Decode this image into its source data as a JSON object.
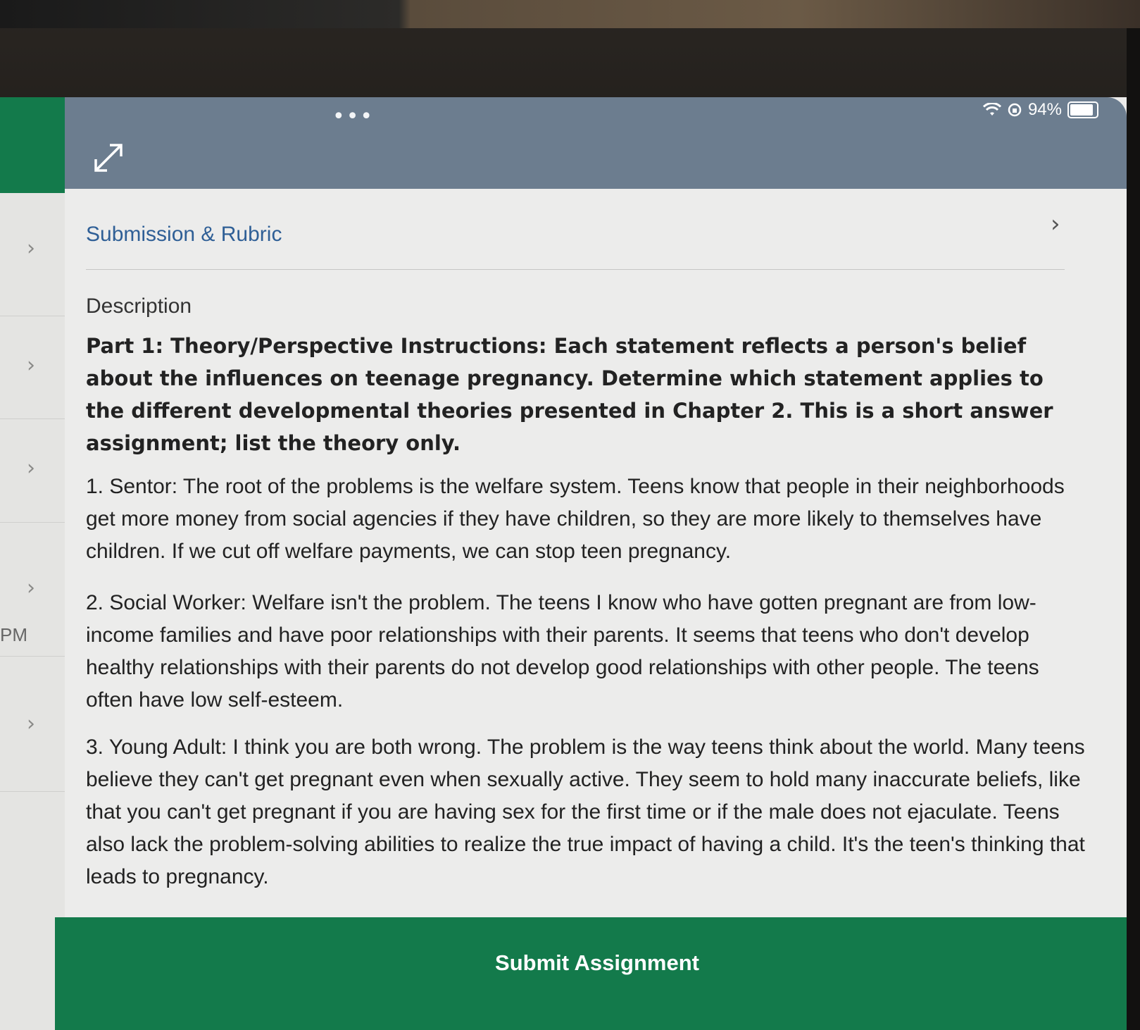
{
  "status_bar": {
    "dots": "•••",
    "battery": "94%"
  },
  "left_list": {
    "partial_text": "PM"
  },
  "header": {
    "tab_link": "Submission & Rubric",
    "section_title": "Description"
  },
  "description": {
    "instructions": "Part 1: Theory/Perspective Instructions:  Each statement reflects a person's belief about the influences on teenage pregnancy. Determine which statement applies to the different developmental theories presented in Chapter 2. This is a short answer assignment; list the theory only.",
    "statements": [
      "1. Sentor: The root of the problems is the welfare system. Teens know that people in their neighborhoods get more money from social agencies if they have children, so they are more likely to themselves have children. If we cut off welfare payments, we can stop teen pregnancy.",
      "2. Social Worker:  Welfare isn't the problem. The teens I know who have gotten pregnant are from low-income families and have poor relationships with their parents.  It seems that teens who don't develop healthy relationships with their parents do not develop good relationships with other people.  The teens often have low self-esteem.",
      "3. Young Adult: I think you are both wrong. The problem is the way teens think about the world. Many teens believe they can't get pregnant even when sexually active. They seem to hold many inaccurate beliefs, like that you can't get pregnant if you are having sex for the first time or if the male does not ejaculate. Teens also lack the problem-solving abilities to realize the true impact of having a child. It's the teen's thinking that leads to pregnancy."
    ]
  },
  "footer": {
    "submit_label": "Submit Assignment"
  },
  "colors": {
    "brand_green": "#137a4b",
    "header_bar": "#6c7d8f",
    "link_blue": "#2f5f96"
  }
}
